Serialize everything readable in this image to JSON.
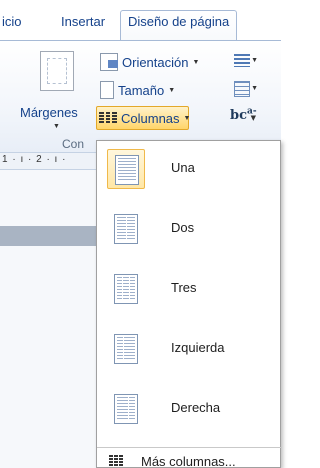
{
  "tabs": [
    {
      "label": "icio"
    },
    {
      "label": "Insertar"
    },
    {
      "label": "Diseño de página",
      "active": true
    }
  ],
  "ribbon": {
    "margins_label": "Márgenes",
    "orientation_label": "Orientación",
    "size_label": "Tamaño",
    "columns_label": "Columnas",
    "group_label": "Con"
  },
  "ruler_text": "1 · ı · 2 · ı ·",
  "columns_menu": {
    "items": [
      {
        "label": "Una",
        "icon": "one-column-icon",
        "highlighted": true
      },
      {
        "label": "Dos",
        "icon": "two-columns-icon"
      },
      {
        "label": "Tres",
        "icon": "three-columns-icon"
      },
      {
        "label": "Izquierda",
        "icon": "left-column-icon"
      },
      {
        "label": "Derecha",
        "icon": "right-column-icon"
      }
    ],
    "more_columns": "Más columnas..."
  },
  "colors": {
    "accent_highlight": "#ffd56a",
    "ribbon_text": "#15428b"
  }
}
